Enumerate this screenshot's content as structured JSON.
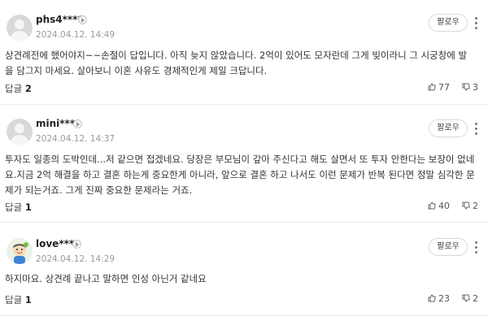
{
  "comments": [
    {
      "username": "phs4****",
      "date": "2024.04.12. 14:49",
      "follow_label": "팔로우",
      "text": "상견례전에 했어야지~~손절이 답입니다. 아직 늦지 않았습니다. 2억이 있어도 모자란데 그게 빚이라니 그 시궁창에 발을 담그지 마세요. 살아보니 이혼 사유도 경제적인게 제일 크답니다.",
      "reply_label": "답글",
      "reply_count": "2",
      "likes": "77",
      "dislikes": "3"
    },
    {
      "username": "mini****",
      "date": "2024.04.12. 14:37",
      "follow_label": "팔로우",
      "text": "투자도 일종의 도박인데...저 같으면 접겠네요. 당장은 부모님이 갚아 주신다고 해도 살면서 또 투자 안한다는 보장이 없네요.지금 2억 해결을 하고 결혼 하는게 중요한게 아니라, 앞으로 결혼 하고 나서도 이런 문제가 반복 된다면 정말 심각한 문제가 되는거죠. 그게 진짜 중요한 문제라는 거죠.",
      "reply_label": "답글",
      "reply_count": "1",
      "likes": "40",
      "dislikes": "2"
    },
    {
      "username": "love****",
      "date": "2024.04.12. 14:29",
      "follow_label": "팔로우",
      "text": "하지마요. 상견례 끝나고 말하면 인성 아닌거 같네요",
      "reply_label": "답글",
      "reply_count": "1",
      "likes": "23",
      "dislikes": "2"
    }
  ]
}
